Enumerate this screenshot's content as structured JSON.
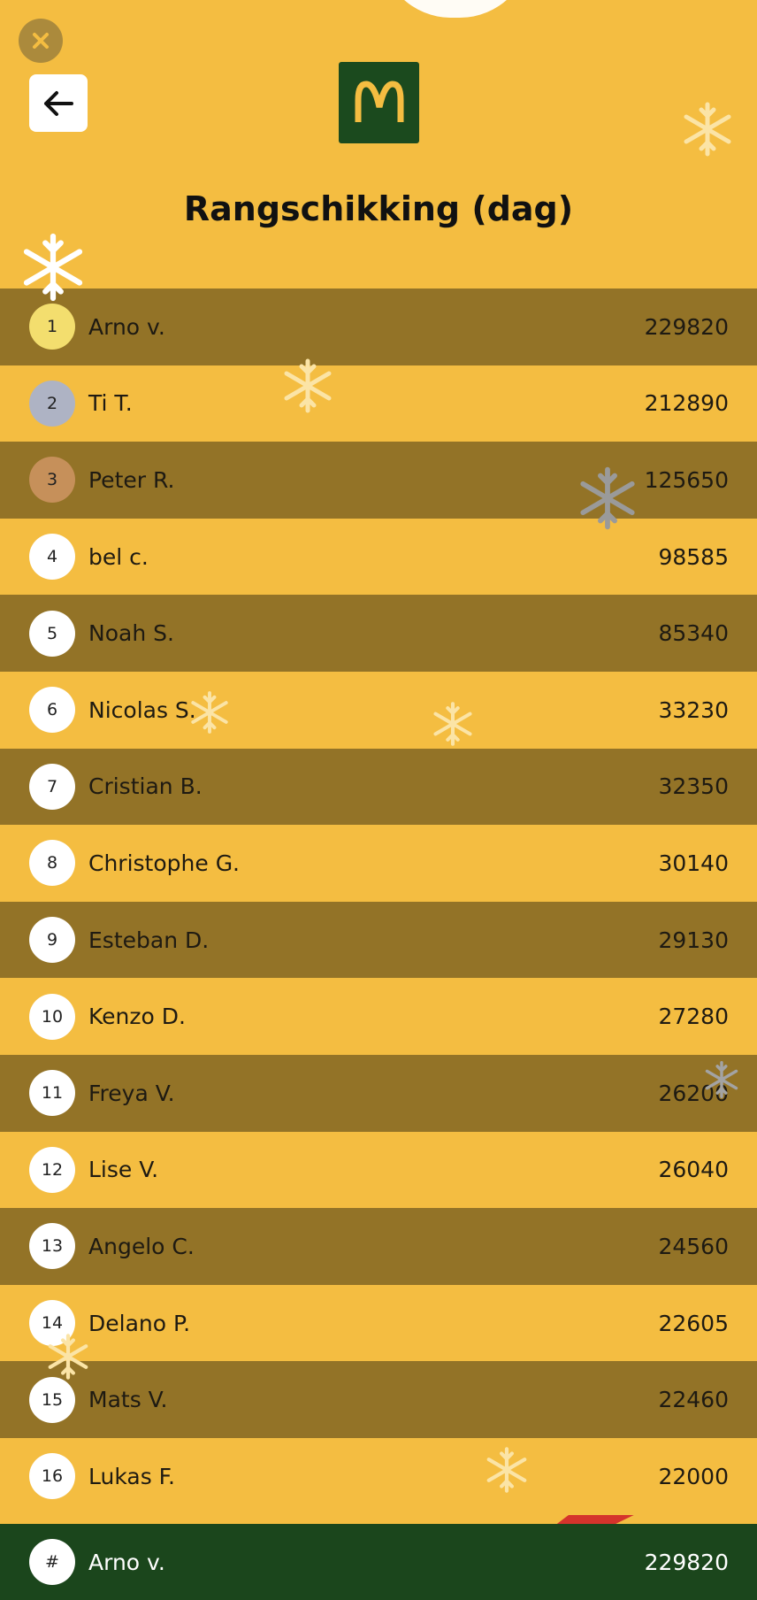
{
  "header": {
    "title": "Rangschikking (dag)"
  },
  "colors": {
    "background": "#f4bd41",
    "row_dark": "#937327",
    "footer": "#1b461c",
    "logo_bg": "#1b4a1e",
    "logo_arches": "#f4bd41",
    "medal_gold": "#f3de6e",
    "medal_silver": "#aeb3c4",
    "medal_bronze": "#c6905a",
    "ribbon": "#d2232a"
  },
  "icons": {
    "close": "close-icon",
    "back": "arrow-left-icon",
    "logo": "mcdonalds-arches-icon",
    "decoration": "snowflake-icon"
  },
  "leaderboard": [
    {
      "rank": "1",
      "name": "Arno v.",
      "score": "229820"
    },
    {
      "rank": "2",
      "name": "Ti T.",
      "score": "212890"
    },
    {
      "rank": "3",
      "name": "Peter R.",
      "score": "125650"
    },
    {
      "rank": "4",
      "name": "bel c.",
      "score": "98585"
    },
    {
      "rank": "5",
      "name": "Noah S.",
      "score": "85340"
    },
    {
      "rank": "6",
      "name": "Nicolas S.",
      "score": "33230"
    },
    {
      "rank": "7",
      "name": "Cristian B.",
      "score": "32350"
    },
    {
      "rank": "8",
      "name": "Christophe G.",
      "score": "30140"
    },
    {
      "rank": "9",
      "name": "Esteban D.",
      "score": "29130"
    },
    {
      "rank": "10",
      "name": "Kenzo D.",
      "score": "27280"
    },
    {
      "rank": "11",
      "name": "Freya V.",
      "score": "26200"
    },
    {
      "rank": "12",
      "name": "Lise V.",
      "score": "26040"
    },
    {
      "rank": "13",
      "name": "Angelo C.",
      "score": "24560"
    },
    {
      "rank": "14",
      "name": "Delano P.",
      "score": "22605"
    },
    {
      "rank": "15",
      "name": "Mats V.",
      "score": "22460"
    },
    {
      "rank": "16",
      "name": "Lukas F.",
      "score": "22000"
    }
  ],
  "current_user": {
    "rank": "#",
    "name": "Arno v.",
    "score": "229820"
  }
}
